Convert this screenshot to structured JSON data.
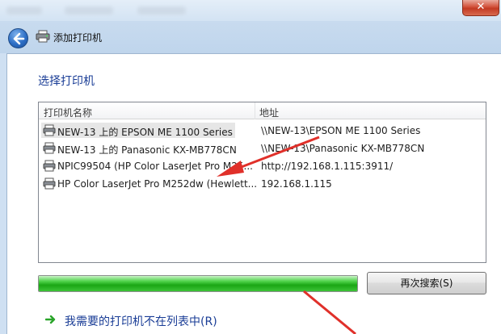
{
  "window": {
    "title": "添加打印机",
    "close_label": "✕"
  },
  "main": {
    "heading": "选择打印机",
    "columns": [
      "打印机名称",
      "地址"
    ],
    "printers": [
      {
        "name": "NEW-13 上的 EPSON ME 1100 Series",
        "address": "\\\\NEW-13\\EPSON ME 1100 Series",
        "selected": true
      },
      {
        "name": "NEW-13 上的 Panasonic KX-MB778CN",
        "address": "\\\\NEW-13\\Panasonic KX-MB778CN",
        "selected": false
      },
      {
        "name": "NPIC99504 (HP Color LaserJet Pro M25...",
        "address": "http://192.168.1.115:3911/",
        "selected": false
      },
      {
        "name": "HP Color LaserJet Pro M252dw (Hewlett...",
        "address": "192.168.1.115",
        "selected": false
      }
    ],
    "search_progress": 1.0,
    "search_again_label": "再次搜索(S)",
    "not_listed_link": "我需要的打印机不在列表中(R)"
  },
  "colors": {
    "heading": "#1a3d96",
    "progress": "#1aa615",
    "annotation": "#e0302a"
  },
  "icons": {
    "back": "back-arrow-icon",
    "printer": "printer-icon",
    "link": "green-arrow-icon"
  }
}
